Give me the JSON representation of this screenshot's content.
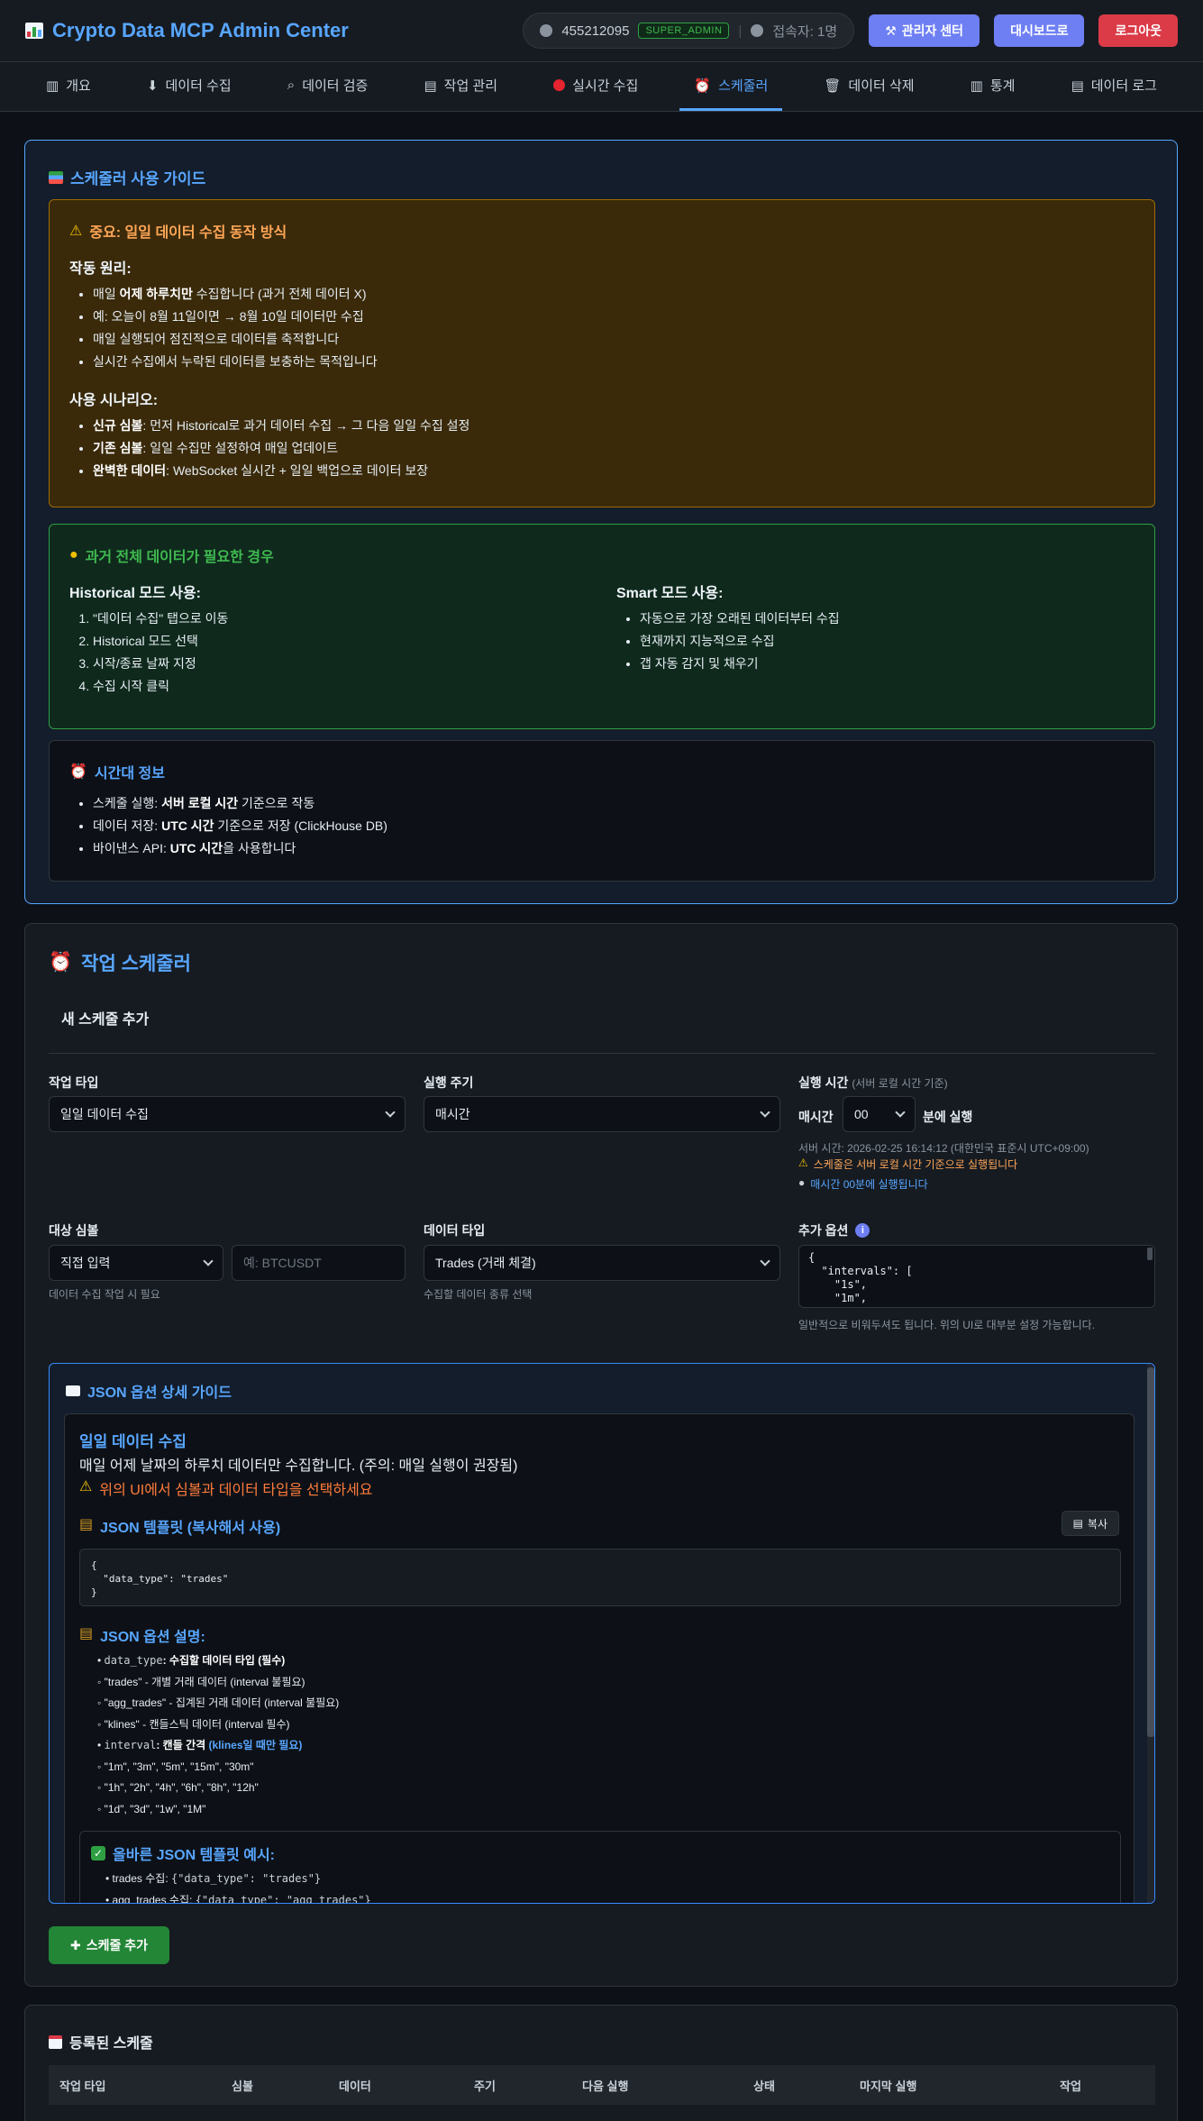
{
  "header": {
    "title": "Crypto Data MCP Admin Center",
    "user_id": "455212095",
    "role": "SUPER_ADMIN",
    "online": "접속자: 1명",
    "admin_btn": "관리자 센터",
    "dashboard_btn": "대시보드로",
    "logout_btn": "로그아웃"
  },
  "nav": [
    {
      "label": "개요"
    },
    {
      "label": "데이터 수집"
    },
    {
      "label": "데이터 검증"
    },
    {
      "label": "작업 관리"
    },
    {
      "label": "실시간 수집"
    },
    {
      "label": "스케줄러"
    },
    {
      "label": "데이터 삭제"
    },
    {
      "label": "통계"
    },
    {
      "label": "데이터 로그"
    }
  ],
  "guide": {
    "title": "스케줄러 사용 가이드",
    "warn_title": "중요: 일일 데이터 수집 동작 방식",
    "principle_title": "작동 원리:",
    "p1_a": "매일 ",
    "p1_b": "어제 하루치만",
    "p1_c": " 수집합니다 (과거 전체 데이터 X)",
    "p2": "예: 오늘이 8월 11일이면 → 8월 10일 데이터만 수집",
    "p3": "매일 실행되어 점진적으로 데이터를 축적합니다",
    "p4": "실시간 수집에서 누락된 데이터를 보충하는 목적입니다",
    "scenario_title": "사용 시나리오:",
    "s1_b": "신규 심볼",
    "s1": ": 먼저 Historical로 과거 데이터 수집 → 그 다음 일일 수집 설정",
    "s2_b": "기존 심볼",
    "s2": ": 일일 수집만 설정하여 매일 업데이트",
    "s3_b": "완벽한 데이터",
    "s3": ": WebSocket 실시간 + 일일 백업으로 데이터 보장",
    "hist_title": "과거 전체 데이터가 필요한 경우",
    "hist_mode": "Historical 모드 사용:",
    "h1": "\"데이터 수집\" 탭으로 이동",
    "h2": "Historical 모드 선택",
    "h3": "시작/종료 날짜 지정",
    "h4": "수집 시작 클릭",
    "smart_mode": "Smart 모드 사용:",
    "m1": "자동으로 가장 오래된 데이터부터 수집",
    "m2": "현재까지 지능적으로 수집",
    "m3": "갭 자동 감지 및 채우기",
    "tz_title": "시간대 정보",
    "t1_a": "스케줄 실행: ",
    "t1_b": "서버 로컬 시간",
    "t1_c": " 기준으로 작동",
    "t2_a": "데이터 저장: ",
    "t2_b": "UTC 시간",
    "t2_c": " 기준으로 저장 (ClickHouse DB)",
    "t3_a": "바이낸스 API: ",
    "t3_b": "UTC 시간",
    "t3_c": "을 사용합니다"
  },
  "scheduler": {
    "title": "작업 스케줄러",
    "new_title": "새 스케줄 추가",
    "job_type_label": "작업 타입",
    "job_type_value": "일일 데이터 수집",
    "period_label": "실행 주기",
    "period_value": "매시간",
    "time_label": "실행 시간",
    "time_label_sub": "(서버 로컬 시간 기준)",
    "every_hour": "매시간",
    "minute_value": "00",
    "minute_suffix": "분에 실행",
    "server_time": "서버 시간: 2026-02-25 16:14:12 (대한민국 표준시 UTC+09:00)",
    "server_warn": "스케줄은 서버 로컬 시간 기준으로 실행됩니다",
    "hourly_info": "매시간 00분에 실행됩니다",
    "symbol_label": "대상 심볼",
    "symbol_mode": "직접 입력",
    "symbol_placeholder": "예: BTCUSDT",
    "symbol_hint": "데이터 수집 작업 시 필요",
    "dtype_label": "데이터 타입",
    "dtype_value": "Trades (거래 체결)",
    "dtype_hint": "수집할 데이터 종류 선택",
    "extra_label": "추가 옵션",
    "extra_l1": "{",
    "extra_l2": "  \"intervals\": [",
    "extra_l3": "    \"1s\",",
    "extra_l4": "    \"1m\",",
    "extra_hint": "일반적으로 비워두셔도 됩니다. 위의 UI로 대부분 설정 가능합니다.",
    "add_btn": "스케줄 추가"
  },
  "json_guide": {
    "title": "JSON 옵션 상세 가이드",
    "daily_title": "일일 데이터 수집",
    "daily_desc": "매일 어제 날짜의 하루치 데이터만 수집합니다. (주의: 매일 실행이 권장됨)",
    "daily_warn": "위의 UI에서 심볼과 데이터 타입을 선택하세요",
    "tpl_title": "JSON 템플릿 (복사해서 사용)",
    "copy_btn": "복사",
    "tpl_l1": "{",
    "tpl_l2": "  \"data_type\": \"trades\"",
    "tpl_l3": "}",
    "opt_title": "JSON 옵션 설명:",
    "o1_code": "data_type",
    "o1": ": 수집할 데이터 타입 (필수)",
    "o2": "\"trades\" - 개별 거래 데이터 (interval 불필요)",
    "o3": "\"agg_trades\" - 집계된 거래 데이터 (interval 불필요)",
    "o4": "\"klines\" - 캔들스틱 데이터 (interval 필수)",
    "o5_code": "interval",
    "o5_a": ": 캔들 간격 ",
    "o5_b": "(klines일 때만 필요)",
    "o6": "\"1m\", \"3m\", \"5m\", \"15m\", \"30m\"",
    "o7": "\"1h\", \"2h\", \"4h\", \"6h\", \"8h\", \"12h\"",
    "o8": "\"1d\", \"3d\", \"1w\", \"1M\"",
    "ex_title": "올바른 JSON 템플릿 예시:",
    "e1_a": "trades 수집: ",
    "e1_code": "{\"data_type\": \"trades\"}",
    "e2_a": "agg_trades 수집: ",
    "e2_code": "{\"data_type\": \"agg_trades\"}"
  },
  "registered": {
    "title": "등록된 스케줄",
    "columns": [
      "작업 타입",
      "심볼",
      "데이터",
      "주기",
      "다음 실행",
      "상태",
      "마지막 실행",
      "작업"
    ]
  }
}
